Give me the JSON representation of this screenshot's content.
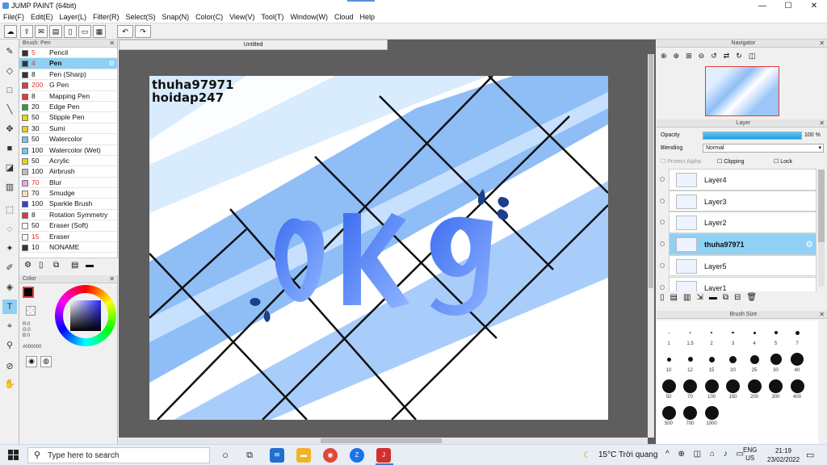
{
  "window": {
    "title": "JUMP PAINT (64bit)",
    "min": "—",
    "max": "☐",
    "close": "✕"
  },
  "menu": [
    "File(F)",
    "Edit(E)",
    "Layer(L)",
    "Filter(R)",
    "Select(S)",
    "Snap(N)",
    "Color(C)",
    "View(V)",
    "Tool(T)",
    "Window(W)",
    "Cloud",
    "Help"
  ],
  "brush_panel": {
    "title": "Brush: Pen",
    "items": [
      {
        "size": "5",
        "name": "Pencil",
        "color": "#333333",
        "size_color": "#e03030"
      },
      {
        "size": "4",
        "name": "Pen",
        "color": "#333333",
        "size_color": "#e03030",
        "selected": true
      },
      {
        "size": "8",
        "name": "Pen (Sharp)",
        "color": "#333333",
        "size_color": "#111111"
      },
      {
        "size": "200",
        "name": "G Pen",
        "color": "#e53935",
        "size_color": "#e03030"
      },
      {
        "size": "8",
        "name": "Mapping Pen",
        "color": "#e53935",
        "size_color": "#111111"
      },
      {
        "size": "20",
        "name": "Edge Pen",
        "color": "#2e9e3a",
        "size_color": "#111111"
      },
      {
        "size": "50",
        "name": "Stipple Pen",
        "color": "#e7d514",
        "size_color": "#111111"
      },
      {
        "size": "30",
        "name": "Sumi",
        "color": "#e7d514",
        "size_color": "#111111"
      },
      {
        "size": "50",
        "name": "Watercolor",
        "color": "#6ec8f0",
        "size_color": "#111111"
      },
      {
        "size": "100",
        "name": "Watercolor (Wet)",
        "color": "#6ec8f0",
        "size_color": "#111111"
      },
      {
        "size": "50",
        "name": "Acrylic",
        "color": "#e7d514",
        "size_color": "#111111"
      },
      {
        "size": "100",
        "name": "Airbrush",
        "color": "#bdbdbd",
        "size_color": "#111111"
      },
      {
        "size": "70",
        "name": "Blur",
        "color": "#f2a0e0",
        "size_color": "#e03030"
      },
      {
        "size": "70",
        "name": "Smudge",
        "color": "#f5e0c0",
        "size_color": "#111111"
      },
      {
        "size": "100",
        "name": "Sparkle Brush",
        "color": "#3344cc",
        "size_color": "#111111"
      },
      {
        "size": "8",
        "name": "Rotation Symmetry",
        "color": "#e53935",
        "size_color": "#111111"
      },
      {
        "size": "50",
        "name": "Eraser (Soft)",
        "color": "#ffffff",
        "size_color": "#111111"
      },
      {
        "size": "15",
        "name": "Eraser",
        "color": "#ffffff",
        "size_color": "#e03030"
      },
      {
        "size": "10",
        "name": "NONAME",
        "color": "#333333",
        "size_color": "#111111"
      }
    ]
  },
  "color_panel": {
    "title": "Color",
    "r": "R:0",
    "g": "G:0",
    "b": "B:0",
    "hex": "#000000"
  },
  "document": {
    "tab": "Untitled",
    "watermark1": "thuha97971",
    "watermark2": "hoidap247"
  },
  "navigator": {
    "title": "Navigator"
  },
  "layer_panel": {
    "title": "Layer",
    "opacity_label": "Opacity",
    "opacity_value": "100 %",
    "opacity_pct": 100,
    "blending_label": "Blending",
    "blending_value": "Normal",
    "protect_alpha": "Protect Alpha",
    "clipping": "Clipping",
    "lock": "Lock",
    "layers": [
      {
        "name": "Layer4",
        "selected": false
      },
      {
        "name": "Layer3",
        "selected": false
      },
      {
        "name": "Layer2",
        "selected": false
      },
      {
        "name": "thuha97971",
        "selected": true
      },
      {
        "name": "Layer5",
        "selected": false
      },
      {
        "name": "Layer1",
        "selected": false
      }
    ]
  },
  "brush_size_panel": {
    "title": "Brush Size",
    "sizes": [
      "1",
      "1.5",
      "2",
      "3",
      "4",
      "5",
      "7",
      "10",
      "12",
      "15",
      "20",
      "25",
      "30",
      "40",
      "50",
      "70",
      "100",
      "150",
      "200",
      "300",
      "400",
      "500",
      "700",
      "1000"
    ]
  },
  "taskbar": {
    "search_placeholder": "Type here to search",
    "weather": "15°C  Trời quang",
    "lang1": "ENG",
    "lang2": "US",
    "time": "21:19",
    "date": "23/02/2022"
  }
}
